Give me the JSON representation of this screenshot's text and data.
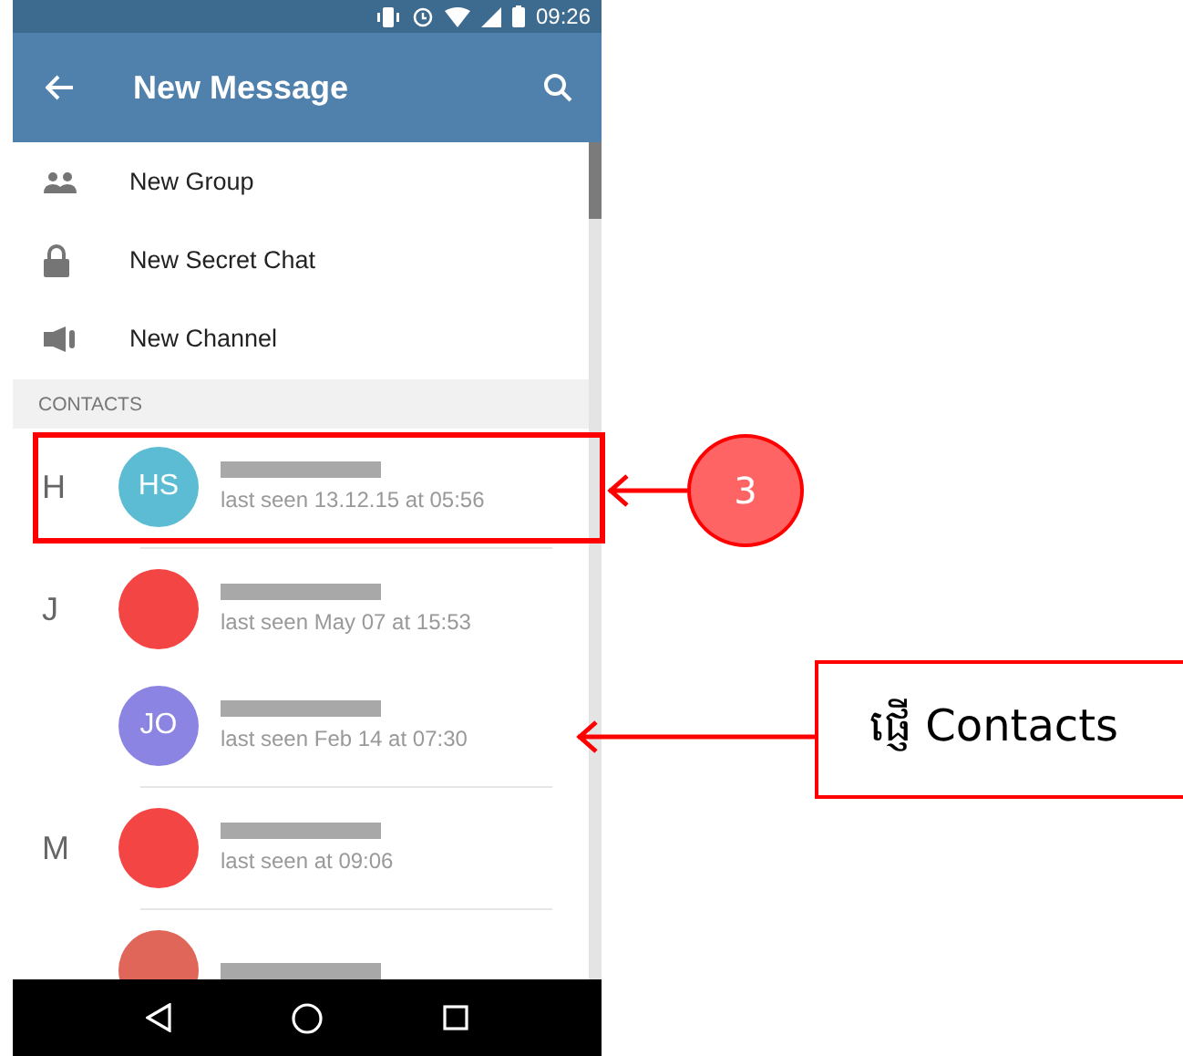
{
  "status_bar": {
    "time": "09:26"
  },
  "app_bar": {
    "title": "New Message"
  },
  "menu": [
    {
      "kind": "group",
      "label": "New Group"
    },
    {
      "kind": "secret",
      "label": "New Secret Chat"
    },
    {
      "kind": "channel",
      "label": "New Channel"
    }
  ],
  "contacts_header": "CONTACTS",
  "sections": [
    {
      "letter": "H",
      "contacts": [
        {
          "initials": "HS",
          "color": "#5bbcd3",
          "status": "last seen 13.12.15 at 05:56"
        }
      ]
    },
    {
      "letter": "J",
      "contacts": [
        {
          "color": "#f44545",
          "status": "last seen May 07 at 15:53"
        },
        {
          "initials": "JO",
          "color": "#8c84e2",
          "status": "last seen Feb 14 at 07:30"
        }
      ]
    },
    {
      "letter": "M",
      "contacts": [
        {
          "color": "#f44545",
          "status": "last seen at 09:06"
        }
      ]
    },
    {
      "contacts": [
        {
          "color": "#e0665a"
        }
      ]
    }
  ],
  "annotations": {
    "step": "3",
    "callout": "ផ្ញើ Contacts"
  }
}
